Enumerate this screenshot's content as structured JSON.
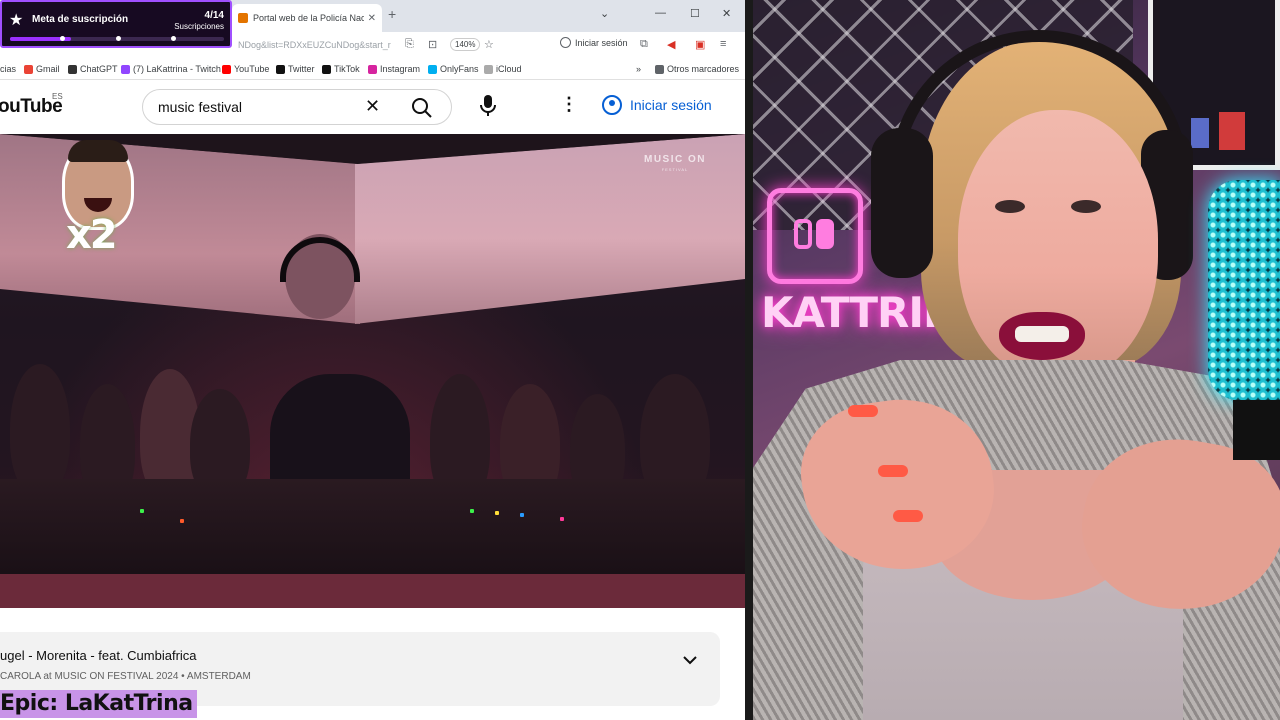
{
  "browser": {
    "active_tab_title": "Portal web de la Policía Naciona",
    "url_fragment": "NDog&list=RDXxEUZCuNDog&start_r",
    "zoom": "140%",
    "signin_chip": "Iniciar sesión"
  },
  "bookmarks": [
    {
      "label": "icias",
      "color": "#777777"
    },
    {
      "label": "Gmail",
      "color": "#ea4335"
    },
    {
      "label": "ChatGPT",
      "color": "#333333"
    },
    {
      "label": "(7) LaKattrina - Twitch",
      "color": "#9146ff"
    },
    {
      "label": "YouTube",
      "color": "#ff0000"
    },
    {
      "label": "Twitter",
      "color": "#111111"
    },
    {
      "label": "TikTok",
      "color": "#111111"
    },
    {
      "label": "Instagram",
      "color": "#d6249f"
    },
    {
      "label": "OnlyFans",
      "color": "#00aff0"
    },
    {
      "label": "iCloud",
      "color": "#aaaaaa"
    },
    {
      "label": "Otros marcadores",
      "color": "#5f6368"
    }
  ],
  "youtube": {
    "logo": "ouTube",
    "region": "ES",
    "search_query": "music festival",
    "signin": "Iniciar sesión"
  },
  "video": {
    "watermark_title": "MUSIC ON",
    "watermark_sub": "FESTIVAL",
    "emote_multiplier": "x2"
  },
  "meta": {
    "title": "ugel - Morenita - feat. Cumbiafrica",
    "subtitle": "CAROLA at MUSIC ON FESTIVAL 2024 • AMSTERDAM"
  },
  "goal": {
    "title": "Meta de suscripción",
    "count": "4/14",
    "unit": "Suscripciones",
    "progress": 0.2857
  },
  "epic_banner": "Epic: LaKatTrina",
  "cam": {
    "neon_text": "KATTRINA"
  },
  "colors": {
    "accent_purple": "#9b30ff",
    "youtube_blue": "#065fd4",
    "neon_pink": "#ff3fd0"
  }
}
